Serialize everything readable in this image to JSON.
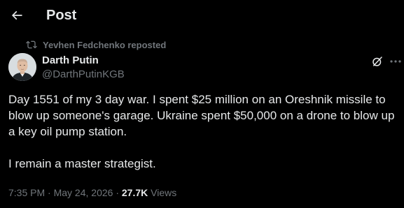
{
  "header": {
    "title": "Post"
  },
  "repost": {
    "text": "Yevhen Fedchenko reposted",
    "icon": "repost-icon"
  },
  "author": {
    "name": "Darth Putin",
    "handle": "@DarthPutinKGB"
  },
  "tweet": {
    "paragraphs": [
      "Day 1551 of my 3 day war. I spent $25 million on an Oreshnik missile to blow up someone's garage. Ukraine spent $50,000 on a drone to blow up a key oil pump station.",
      "I remain a master strategist."
    ]
  },
  "meta": {
    "time": "7:35 PM",
    "separator": " · ",
    "date": "May 24, 2026",
    "views_count": "27.7K",
    "views_label": " Views"
  },
  "colors": {
    "background": "#000000",
    "text": "#e7e9ea",
    "muted": "#71767b"
  }
}
